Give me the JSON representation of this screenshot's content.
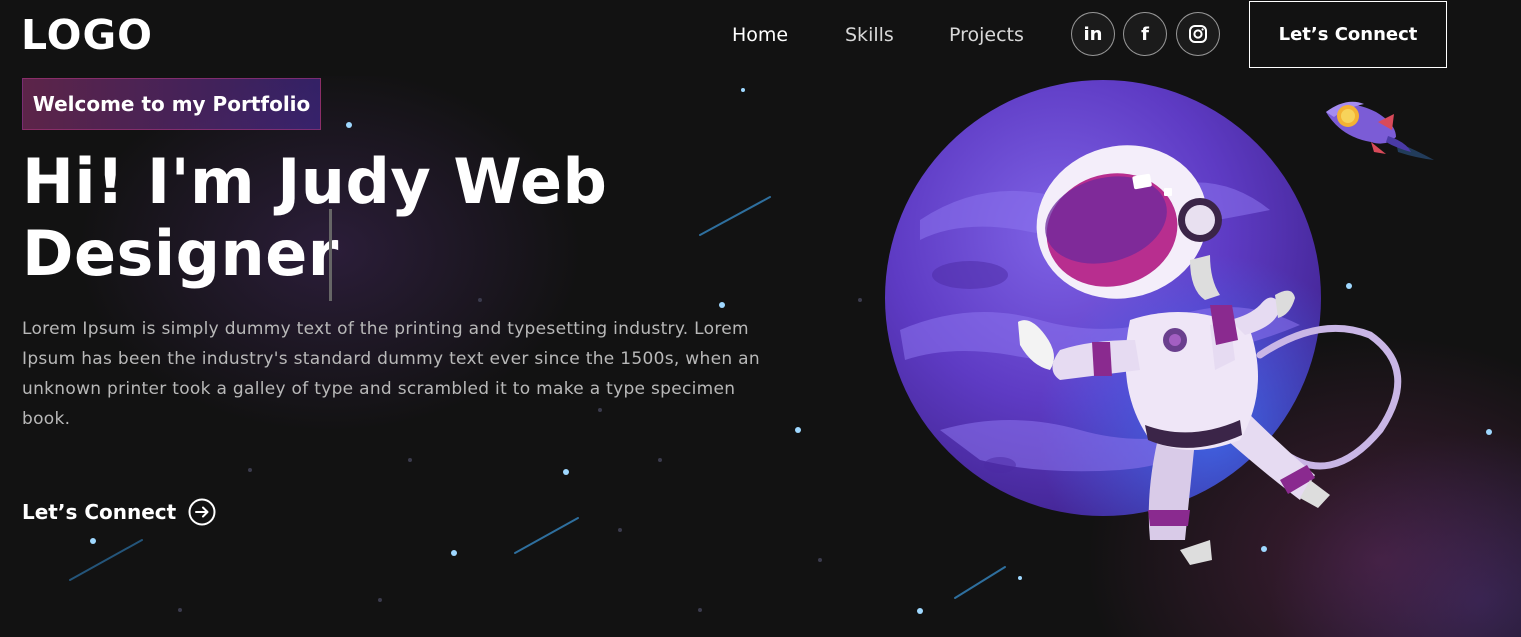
{
  "nav": {
    "logo": "LOGO",
    "links": [
      "Home",
      "Skills",
      "Projects"
    ],
    "social": [
      {
        "icon": "linkedin-icon",
        "glyph": "in"
      },
      {
        "icon": "facebook-icon",
        "glyph": "f"
      },
      {
        "icon": "instagram-icon",
        "glyph": ""
      }
    ],
    "connect_label": "Let’s Connect"
  },
  "hero": {
    "tagline": "Welcome to my Portfolio",
    "headline": "Hi! I'm Judy Web Designer",
    "description": "Lorem Ipsum is simply dummy text of the printing and typesetting industry. Lorem Ipsum has been the industry's standard dummy text ever since the 1500s, when an unknown printer took a galley of type and scrambled it to make a type specimen book.",
    "cta_label": "Let’s Connect"
  },
  "colors": {
    "background": "#121212",
    "tagline_gradient_start": "#AA367C",
    "tagline_gradient_end": "#4A2FBD",
    "planet": "#6a3fd0",
    "text_muted": "#b8b8b8"
  }
}
